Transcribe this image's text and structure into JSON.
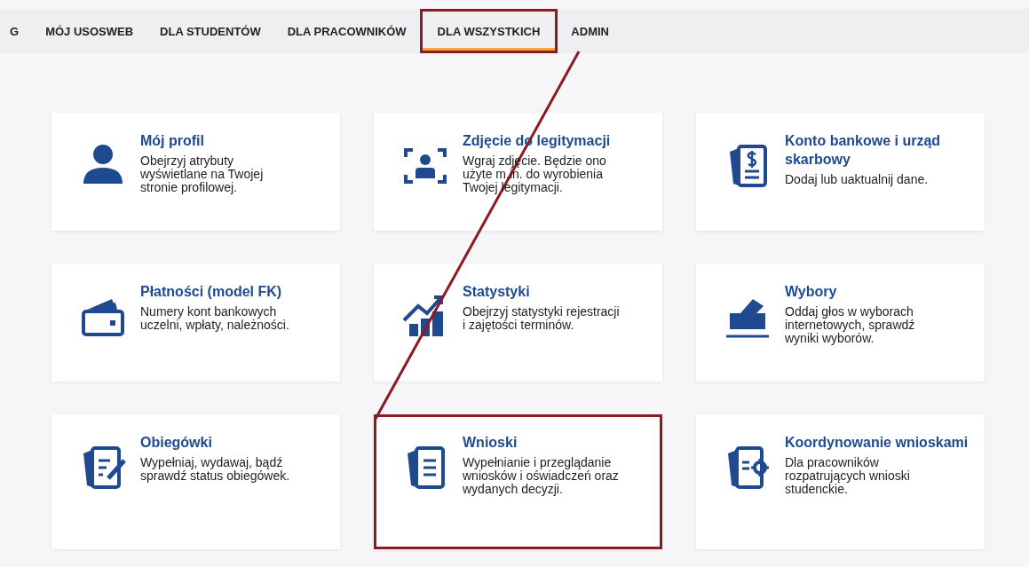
{
  "tabs": [
    {
      "label": "G",
      "selected": false,
      "highlighted": false
    },
    {
      "label": "MÓJ USOSWEB",
      "selected": false,
      "highlighted": false
    },
    {
      "label": "DLA STUDENTÓW",
      "selected": false,
      "highlighted": false
    },
    {
      "label": "DLA PRACOWNIKÓW",
      "selected": false,
      "highlighted": false
    },
    {
      "label": "DLA WSZYSTKICH",
      "selected": true,
      "highlighted": true
    },
    {
      "label": "ADMIN",
      "selected": false,
      "highlighted": false
    }
  ],
  "tiles": [
    {
      "title": "Mój profil",
      "description": "Obejrzyj atrybuty wyświetlane na Twojej stronie profilowej.",
      "highlighted": false
    },
    {
      "title": "Zdjęcie do legitymacji",
      "description": "Wgraj zdjęcie. Będzie ono użyte m.in. do wyrobienia Twojej legitymacji.",
      "highlighted": false
    },
    {
      "title": "Konto bankowe i urząd skarbowy",
      "description": "Dodaj lub uaktualnij dane.",
      "highlighted": false
    },
    {
      "title": "Płatności (model FK)",
      "description": "Numery kont bankowych uczelni, wpłaty, należności.",
      "highlighted": false
    },
    {
      "title": "Statystyki",
      "description": "Obejrzyj statystyki rejestracji i zajętości terminów.",
      "highlighted": false
    },
    {
      "title": "Wybory",
      "description": "Oddaj głos w wyborach internetowych, sprawdź wyniki wyborów.",
      "highlighted": false
    },
    {
      "title": "Obiegówki",
      "description": "Wypełniaj, wydawaj, bądź sprawdź status obiegówek.",
      "highlighted": false
    },
    {
      "title": "Wnioski",
      "description": "Wypełnianie i przeglądanie wniosków i oświadczeń oraz wydanych decyzji.",
      "highlighted": true
    },
    {
      "title": "Koordynowanie wnioskami",
      "description": "Dla pracowników rozpatrujących wnioski studenckie.",
      "highlighted": false
    }
  ]
}
